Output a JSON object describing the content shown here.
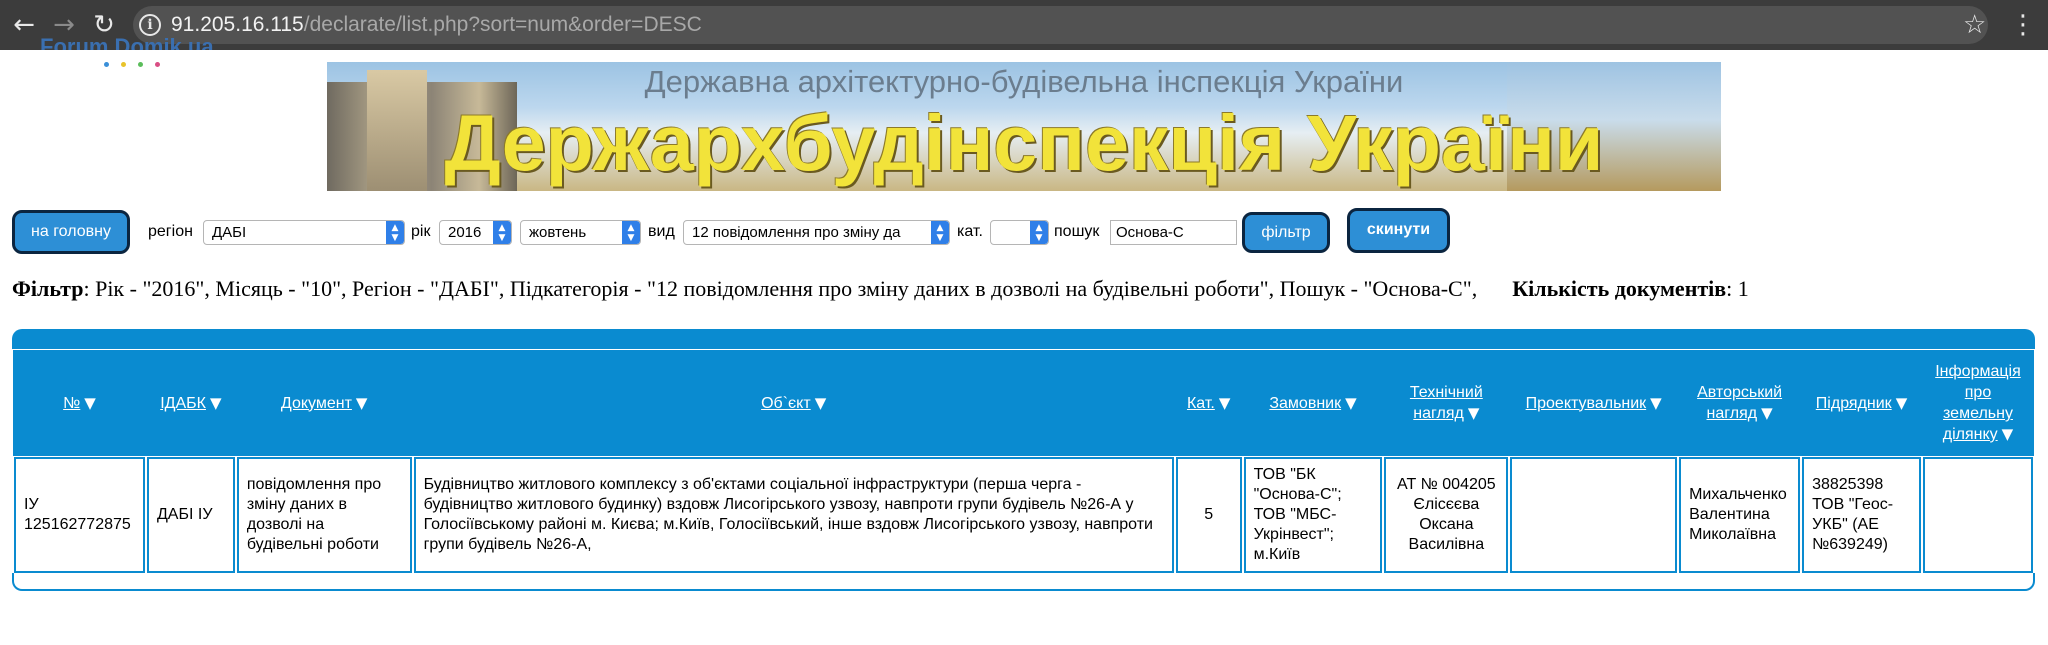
{
  "browser": {
    "url_host": "91.205.16.115",
    "url_path": "/declarate/list.php?sort=num&order=DESC"
  },
  "logo": {
    "text": "Forum.Domik.ua"
  },
  "banner": {
    "subtitle": "Державна архітектурно-будівельна інспекція України",
    "title": "Держархбудінспекція України"
  },
  "filters": {
    "home_button": "на головну",
    "region_label": "регіон",
    "region_value": "ДАБІ",
    "year_label": "рік",
    "year_value": "2016",
    "month_value": "жовтень",
    "type_label": "вид",
    "type_value": "12 повідомлення про зміну да",
    "category_label": "кат.",
    "category_value": "",
    "search_label": "пошук",
    "search_value": "Основа-С",
    "filter_button": "фільтр",
    "reset_button": "скинути"
  },
  "summary": {
    "filter_label": "Фільтр",
    "filter_text": ": Рік - \"2016\", Місяць - \"10\", Регіон - \"ДАБІ\", Підкатегорія - \"12 повідомлення про зміну даних в дозволі на будівельні роботи\", Пошук - \"Основа-С\",",
    "count_label": "Кількість документів",
    "count_value": ": 1"
  },
  "table": {
    "headers": {
      "num": "№",
      "idabk": "ІДАБК",
      "doc": "Документ",
      "object": "Об`єкт",
      "cat": "Кат.",
      "customer": "Замовник",
      "tech": "Технічний нагляд",
      "designer": "Проектувальник",
      "author": "Авторський нагляд",
      "contractor": "Підрядник",
      "land": "Інформація про земельну ділянку"
    },
    "rows": [
      {
        "num": "ІУ 125162772875",
        "idabk": "ДАБІ ІУ",
        "doc": "повідомлення про зміну даних в дозволі на будівельні роботи",
        "object": "Будівництво житлового комплексу з об'єктами соціальної інфраструктури (перша черга - будівництво житлового будинку) вздовж Лисогірського узвозу, навпроти групи будівель №26-А у Голосіївському районі м. Києва; м.Київ, Голосіївський, інше вздовж Лисогірського узвозу, навпроти групи будівель №26-А,",
        "cat": "5",
        "customer": "ТОВ \"БК \"Основа-С\"; ТОВ \"МБС-Укрінвест\"; м.Київ",
        "tech": "АТ № 004205 Єлісєєва Оксана Василівна",
        "designer": "",
        "author": "Михальченко Валентина Миколаївна",
        "contractor": "38825398 ТОВ \"Геос-УКБ\" (АЕ №639249)",
        "land": ""
      }
    ]
  },
  "colors": {
    "accent": "#0a8bd0",
    "button": "#2d8fd6",
    "chrome": "#3c3c3c"
  },
  "icons": [
    "back-arrow-icon",
    "forward-arrow-icon",
    "reload-icon",
    "info-icon",
    "star-icon",
    "menu-icon",
    "sort-down-icon",
    "dropdown-arrow-icon"
  ]
}
